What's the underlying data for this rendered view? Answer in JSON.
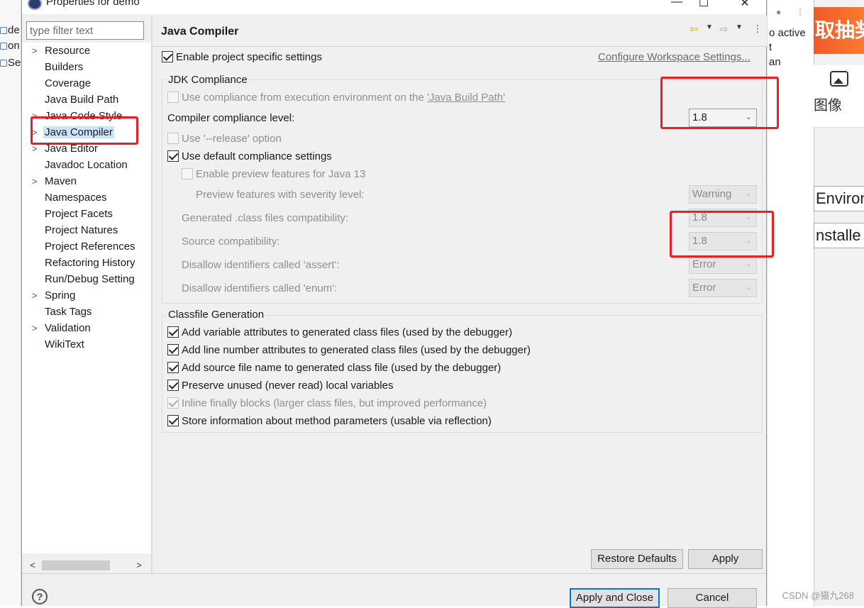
{
  "background": {
    "left_items": [
      "de",
      "on",
      "Se"
    ],
    "right_texts": [
      "o active",
      "t",
      "an"
    ],
    "banner_text": "取抽奖",
    "image_tool_label": "图像",
    "fragment_buttons": [
      "Environ",
      "nstalle"
    ],
    "watermark": "CSDN @猫九268"
  },
  "dialog": {
    "title": "Properties for demo",
    "window_buttons": {
      "minimize": "—",
      "maximize": "☐",
      "close": "✕"
    },
    "filter": {
      "placeholder": "type filter text"
    },
    "tree": [
      {
        "label": "Resource",
        "expandable": true
      },
      {
        "label": "Builders",
        "expandable": false
      },
      {
        "label": "Coverage",
        "expandable": false
      },
      {
        "label": "Java Build Path",
        "expandable": false
      },
      {
        "label": "Java Code Style",
        "expandable": true
      },
      {
        "label": "Java Compiler",
        "expandable": true,
        "selected": true
      },
      {
        "label": "Java Editor",
        "expandable": true
      },
      {
        "label": "Javadoc Location",
        "expandable": false
      },
      {
        "label": "Maven",
        "expandable": true
      },
      {
        "label": "Namespaces",
        "expandable": false
      },
      {
        "label": "Project Facets",
        "expandable": false
      },
      {
        "label": "Project Natures",
        "expandable": false
      },
      {
        "label": "Project References",
        "expandable": false
      },
      {
        "label": "Refactoring History",
        "expandable": false
      },
      {
        "label": "Run/Debug Setting",
        "expandable": false
      },
      {
        "label": "Spring",
        "expandable": true
      },
      {
        "label": "Task Tags",
        "expandable": false
      },
      {
        "label": "Validation",
        "expandable": true
      },
      {
        "label": "WikiText",
        "expandable": false
      }
    ],
    "page": {
      "title": "Java Compiler",
      "enable_specific": {
        "label": "Enable project specific settings",
        "checked": true
      },
      "configure_link": "Configure Workspace Settings...",
      "jdk": {
        "group_title": "JDK Compliance",
        "use_compliance_env": {
          "label_prefix": "Use compliance from execution environment on the ",
          "link": "'Java Build Path'",
          "checked": false,
          "enabled": false
        },
        "compliance_level": {
          "label": "Compiler compliance level:",
          "value": "1.8"
        },
        "use_release": {
          "label": "Use '--release' option",
          "checked": false,
          "enabled": false
        },
        "use_default": {
          "label": "Use default compliance settings",
          "checked": true
        },
        "enable_preview": {
          "label": "Enable preview features for Java 13",
          "checked": false,
          "enabled": false
        },
        "preview_severity": {
          "label": "Preview features with severity level:",
          "value": "Warning"
        },
        "class_compat": {
          "label": "Generated .class files compatibility:",
          "value": "1.8"
        },
        "source_compat": {
          "label": "Source compatibility:",
          "value": "1.8"
        },
        "disallow_assert": {
          "label": "Disallow identifiers called 'assert':",
          "value": "Error"
        },
        "disallow_enum": {
          "label": "Disallow identifiers called 'enum':",
          "value": "Error"
        }
      },
      "classfile": {
        "group_title": "Classfile Generation",
        "options": [
          {
            "label": "Add variable attributes to generated class files (used by the debugger)",
            "checked": true,
            "enabled": true
          },
          {
            "label": "Add line number attributes to generated class files (used by the debugger)",
            "checked": true,
            "enabled": true
          },
          {
            "label": "Add source file name to generated class file (used by the debugger)",
            "checked": true,
            "enabled": true
          },
          {
            "label": "Preserve unused (never read) local variables",
            "checked": true,
            "enabled": true
          },
          {
            "label": "Inline finally blocks (larger class files, but improved performance)",
            "checked": true,
            "enabled": false
          },
          {
            "label": "Store information about method parameters (usable via reflection)",
            "checked": true,
            "enabled": true
          }
        ]
      },
      "restore_defaults": "Restore Defaults",
      "apply": "Apply"
    },
    "apply_and_close": "Apply and Close",
    "cancel": "Cancel",
    "help": "?"
  },
  "colors": {
    "annotation": "#ee1d24",
    "selection": "#cce4f7",
    "primary_border": "#0078d7"
  }
}
